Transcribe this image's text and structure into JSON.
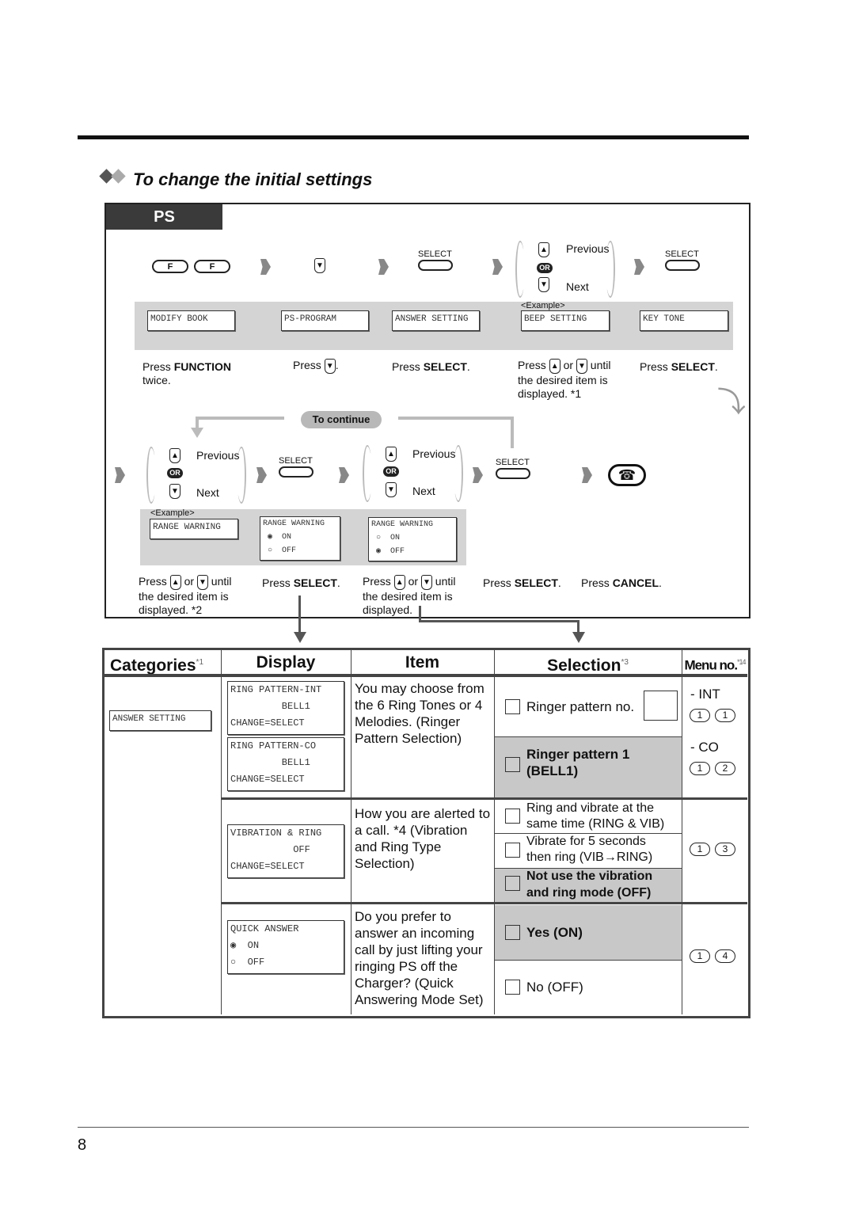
{
  "title": "To change the initial settings",
  "tab": "PS",
  "step1": {
    "function_key": "F",
    "select_label": "SELECT",
    "previous": "Previous",
    "next": "Next",
    "or": "OR",
    "example": "<Example>",
    "displays": [
      "MODIFY BOOK",
      "PS-PROGRAM",
      "ANSWER SETTING",
      "BEEP SETTING",
      "KEY TONE"
    ],
    "captions": [
      {
        "pre": "Press ",
        "bold": "FUNCTION",
        "post": "",
        "line2": "twice."
      },
      {
        "pre": "Press ",
        "bold": "",
        "post": ".",
        "line2": ""
      },
      {
        "pre": "Press ",
        "bold": "SELECT",
        "post": ".",
        "line2": ""
      },
      {
        "pre": "Press ",
        "mid": " or ",
        "post": " until",
        "line2": "the desired item  is",
        "line3": "displayed. *1"
      },
      {
        "pre": "Press ",
        "bold": "SELECT",
        "post": ".",
        "line2": ""
      }
    ]
  },
  "to_continue": "To continue",
  "step2": {
    "previous": "Previous",
    "next": "Next",
    "or": "OR",
    "select_label": "SELECT",
    "example": "<Example>",
    "display1": "RANGE WARNING",
    "display2": "RANGE WARNING\n ◉  ON\n ○  OFF",
    "display3": "RANGE WARNING\n ○  ON\n ◉  OFF",
    "captions": {
      "c1a": "Press ",
      "c1b": " or ",
      "c1c": " until",
      "c1d": "the desired item  is",
      "c1e": "displayed. *2",
      "c2a": "Press ",
      "c2b": "SELECT",
      "c3a": "Press ",
      "c3b": " or ",
      "c3c": " until",
      "c3d": "the desired item is",
      "c3e": "displayed.",
      "c4a": "Press ",
      "c4b": "SELECT",
      "c5a": "Press ",
      "c5b": "CANCEL"
    }
  },
  "table": {
    "headers": {
      "categories": "Categories",
      "cat_note": "*1",
      "display": "Display",
      "item": "Item",
      "selection": "Selection",
      "sel_note": "*3",
      "menu": "Menu no.",
      "menu_note": "*14"
    },
    "category": "ANSWER SETTING",
    "rows": [
      {
        "displays": [
          "RING PATTERN-INT\n         BELL1\nCHANGE=SELECT",
          "RING PATTERN-CO\n         BELL1\nCHANGE=SELECT"
        ],
        "item": "You may choose from the 6 Ring Tones or 4 Melodies. (Ringer Pattern Selection)",
        "options": [
          {
            "label": "Ringer pattern no.",
            "default": false
          },
          {
            "label": "Ringer pattern 1 (BELL1)",
            "default": true
          }
        ],
        "menu": [
          {
            "label": "- INT",
            "keys": [
              "1",
              "1"
            ]
          },
          {
            "label": "- CO",
            "keys": [
              "1",
              "2"
            ]
          }
        ]
      },
      {
        "displays": [
          "VIBRATION & RING\n           OFF\nCHANGE=SELECT"
        ],
        "item": "How you are alerted to a call. *4 (Vibration and Ring Type Selection)",
        "options": [
          {
            "label": "Ring and vibrate at the same time  (RING & VIB)",
            "default": false
          },
          {
            "label": "Vibrate for 5 seconds then ring  (VIB→RING)",
            "default": false
          },
          {
            "label": "Not use the vibration and ring mode (OFF)",
            "default": true
          }
        ],
        "menu": [
          {
            "keys": [
              "1",
              "3"
            ]
          }
        ]
      },
      {
        "displays": [
          "QUICK ANSWER\n◉  ON\n○  OFF"
        ],
        "item": "Do you prefer to answer an incoming call by just lifting your ringing PS off the Charger? (Quick Answering Mode Set)",
        "options": [
          {
            "label": "Yes (ON)",
            "default": true
          },
          {
            "label": "No (OFF)",
            "default": false
          }
        ],
        "menu": [
          {
            "keys": [
              "1",
              "4"
            ]
          }
        ]
      }
    ]
  },
  "page_number": "8"
}
